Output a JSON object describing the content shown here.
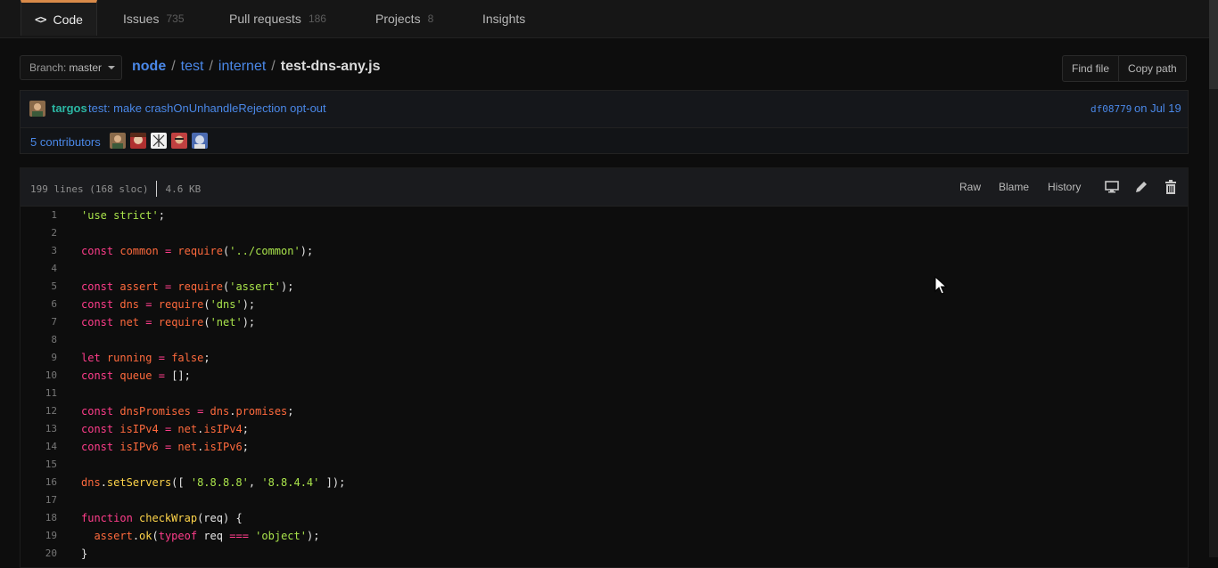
{
  "nav": {
    "tabs": [
      {
        "label": "Code",
        "count": ""
      },
      {
        "label": "Issues",
        "count": "735"
      },
      {
        "label": "Pull requests",
        "count": "186"
      },
      {
        "label": "Projects",
        "count": "8"
      },
      {
        "label": "Insights",
        "count": ""
      }
    ]
  },
  "branch": {
    "prefix": "Branch:",
    "value": "master"
  },
  "breadcrumb": {
    "repo": "node",
    "sep": "/",
    "dir1": "test",
    "dir2": "internet",
    "file": "test-dns-any.js"
  },
  "file_buttons": {
    "find_file": "Find file",
    "copy_path": "Copy path"
  },
  "commit": {
    "author": "targos",
    "message": "test: make crashOnUnhandleRejection opt-out",
    "sha": "df08779",
    "date": "on Jul 19"
  },
  "contributors": {
    "label": "5 contributors"
  },
  "file": {
    "lines_info": "199 lines (168 sloc)",
    "size": "4.6 KB",
    "raw": "Raw",
    "blame": "Blame",
    "history": "History"
  },
  "code_lines": [
    {
      "n": "1",
      "text": "'use strict';"
    },
    {
      "n": "2",
      "text": ""
    },
    {
      "n": "3",
      "text": "const common = require('../common');"
    },
    {
      "n": "4",
      "text": ""
    },
    {
      "n": "5",
      "text": "const assert = require('assert');"
    },
    {
      "n": "6",
      "text": "const dns = require('dns');"
    },
    {
      "n": "7",
      "text": "const net = require('net');"
    },
    {
      "n": "8",
      "text": ""
    },
    {
      "n": "9",
      "text": "let running = false;"
    },
    {
      "n": "10",
      "text": "const queue = [];"
    },
    {
      "n": "11",
      "text": ""
    },
    {
      "n": "12",
      "text": "const dnsPromises = dns.promises;"
    },
    {
      "n": "13",
      "text": "const isIPv4 = net.isIPv4;"
    },
    {
      "n": "14",
      "text": "const isIPv6 = net.isIPv6;"
    },
    {
      "n": "15",
      "text": ""
    },
    {
      "n": "16",
      "text": "dns.setServers([ '8.8.8.8', '8.8.4.4' ]);"
    },
    {
      "n": "17",
      "text": ""
    },
    {
      "n": "18",
      "text": "function checkWrap(req) {"
    },
    {
      "n": "19",
      "text": "  assert.ok(typeof req === 'object');"
    },
    {
      "n": "20",
      "text": "}"
    }
  ]
}
